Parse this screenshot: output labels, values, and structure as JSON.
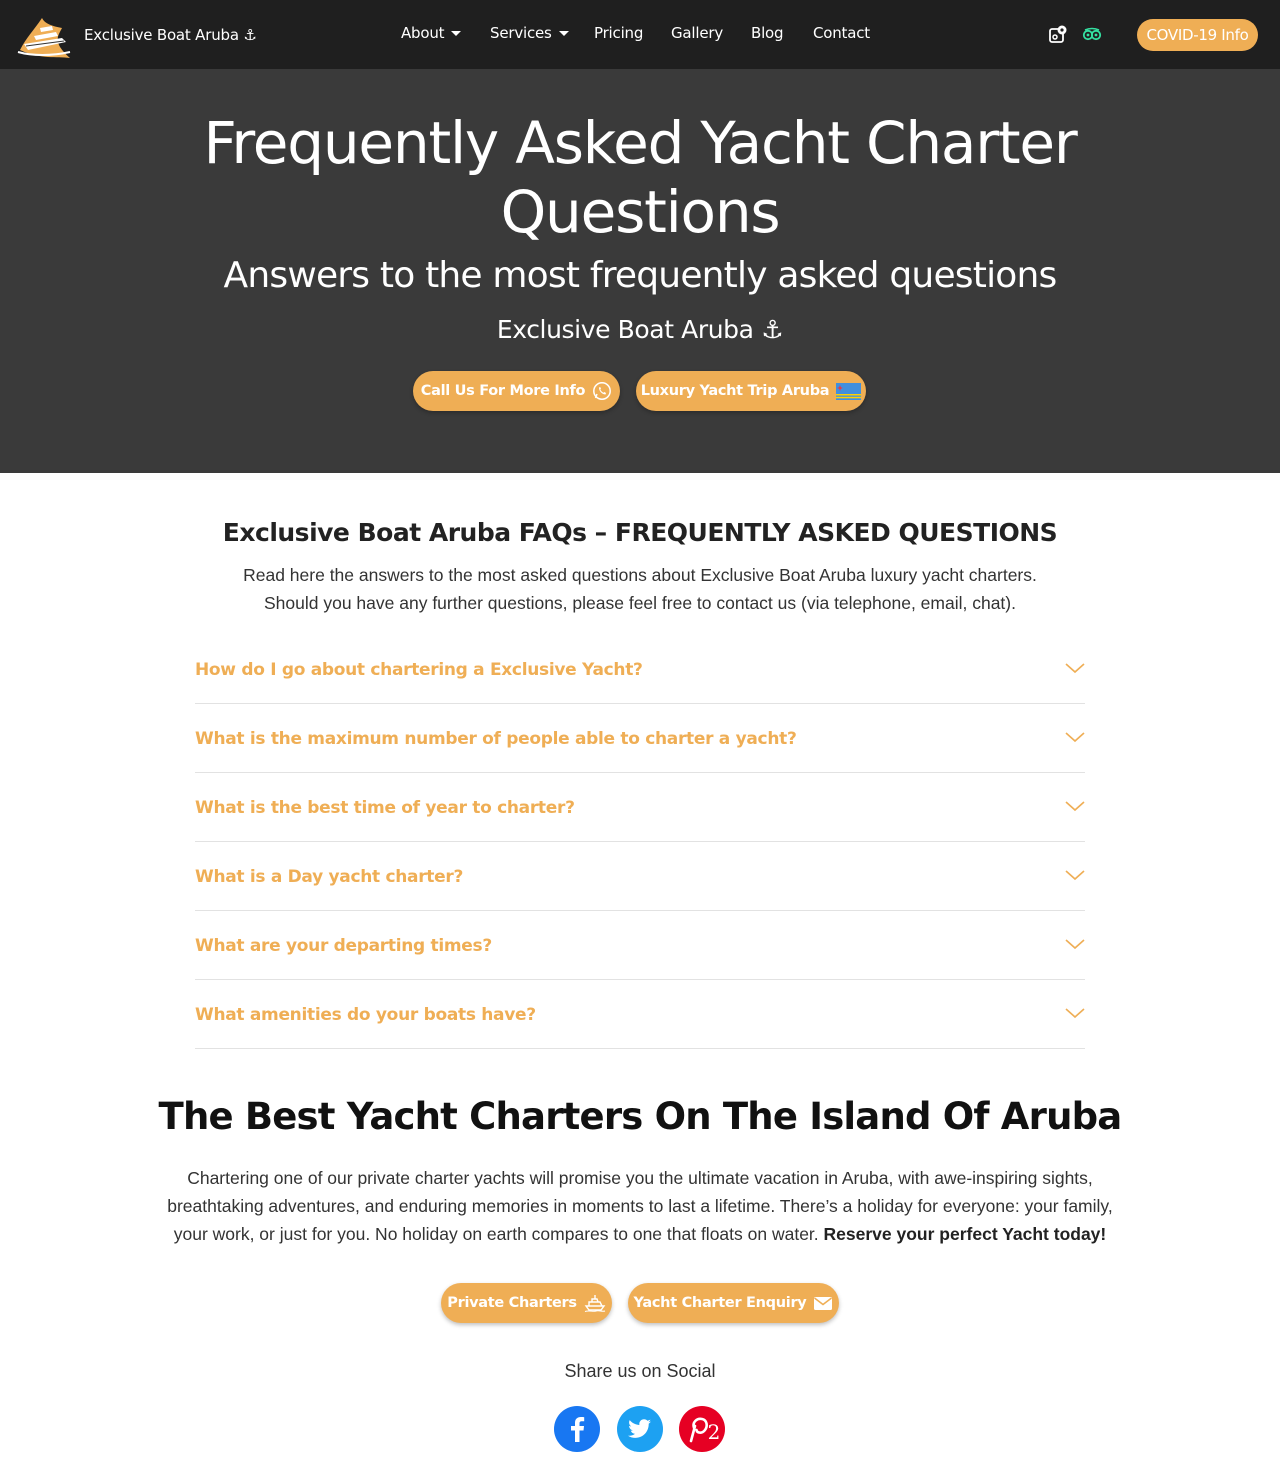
{
  "nav": {
    "brand": "Exclusive Boat Aruba ⚓",
    "items": [
      {
        "label": "About",
        "dropdown": true
      },
      {
        "label": "Services",
        "dropdown": true
      },
      {
        "label": "Pricing",
        "dropdown": false
      },
      {
        "label": "Gallery",
        "dropdown": false
      },
      {
        "label": "Blog",
        "dropdown": false
      },
      {
        "label": "Contact",
        "dropdown": false
      }
    ],
    "icons": [
      "map-marker-icon",
      "tripadvisor-icon"
    ],
    "covid_button": "COVID-19 Info"
  },
  "hero": {
    "title_line1": "Frequently Asked Yacht Charter",
    "title_line2": "Questions",
    "subtitle": "Answers to the most frequently asked questions",
    "brand": "Exclusive Boat Aruba ⚓",
    "call_button": "Call Us For More Info",
    "trip_button": "Luxury Yacht Trip Aruba"
  },
  "faq": {
    "heading": "Exclusive Boat Aruba FAQs – FREQUENTLY ASKED QUESTIONS",
    "intro_line1": "Read here the answers to the most asked questions about Exclusive Boat Aruba luxury yacht charters.",
    "intro_line2": "Should you have any further questions, please feel free to contact us (via telephone, email, chat).",
    "items": [
      "How do I go about chartering a Exclusive Yacht?",
      "What is the maximum number of people able to charter a yacht?",
      "What is the best time of year to charter?",
      "What is a Day yacht charter?",
      "What are your departing times?",
      "What amenities do your boats have?"
    ]
  },
  "best": {
    "title": "The Best Yacht Charters On The Island Of Aruba",
    "text_line1": "Chartering one of our private charter yachts will promise you the ultimate vacation in Aruba, with awe-inspiring sights,",
    "text_line2": "breathtaking adventures, and enduring memories in moments to last a lifetime. There’s a holiday for everyone: your family,",
    "text_line3": "your work, or just for you. No holiday on earth compares to one that floats on water.",
    "text_bold": "Reserve your perfect Yacht today!",
    "private_button": "Private Charters",
    "enquiry_button": "Yacht Charter Enquiry"
  },
  "share": {
    "label": "Share us on Social",
    "pinterest_count": "2"
  },
  "colors": {
    "accent": "#efae55",
    "navbar": "#1f1f1f",
    "hero": "#3a3a3a",
    "facebook": "#1877f2",
    "twitter": "#1da1f2",
    "pinterest": "#e60023"
  }
}
